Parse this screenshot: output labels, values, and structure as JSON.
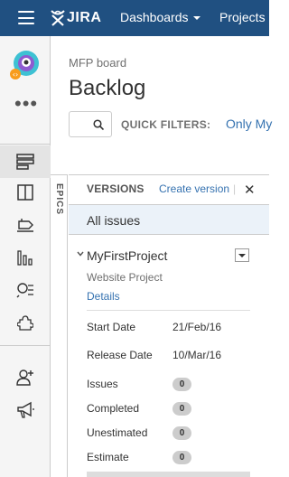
{
  "topbar": {
    "logo_text": "JIRA",
    "nav": [
      {
        "label": "Dashboards",
        "has_caret": true
      },
      {
        "label": "Projects",
        "has_caret": false
      }
    ],
    "background": "#205081"
  },
  "sidebar": {
    "more_label": "•••",
    "icons": [
      "project-avatar-icon",
      "backlog-icon",
      "active-sprints-icon",
      "releases-icon",
      "reports-icon",
      "issues-search-icon",
      "components-icon",
      "add-people-icon",
      "feedback-megaphone-icon"
    ]
  },
  "header": {
    "breadcrumb": "MFP board",
    "title": "Backlog"
  },
  "filters": {
    "label": "QUICK FILTERS:",
    "first_filter": "Only My"
  },
  "epics_tab": {
    "label": "EPICS"
  },
  "versions_panel": {
    "title": "VERSIONS",
    "create_link": "Create version",
    "separator": "|",
    "close": "✕",
    "all_issues": "All issues",
    "version": {
      "name": "MyFirstProject",
      "description": "Website Project",
      "details_link": "Details",
      "start_date_label": "Start Date",
      "start_date": "21/Feb/16",
      "release_date_label": "Release Date",
      "release_date": "10/Mar/16",
      "stats": [
        {
          "label": "Issues",
          "count": "0"
        },
        {
          "label": "Completed",
          "count": "0"
        },
        {
          "label": "Unestimated",
          "count": "0"
        },
        {
          "label": "Estimate",
          "count": "0"
        }
      ]
    }
  },
  "colors": {
    "link": "#3572b0",
    "selected_bg": "#ebf2f9",
    "badge": "#cccccc"
  }
}
